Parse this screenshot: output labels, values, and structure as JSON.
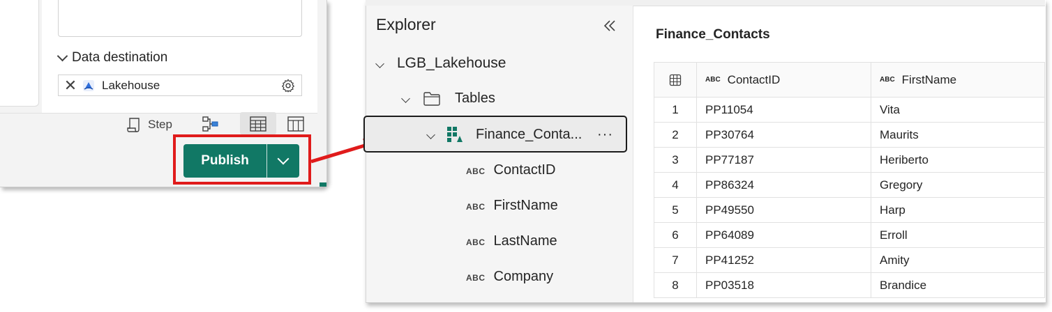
{
  "left_window": {
    "data_destination_label": "Data destination",
    "destination_value": "Lakehouse",
    "step_label": "Step",
    "publish_label": "Publish"
  },
  "explorer": {
    "title": "Explorer",
    "lakehouse": "LGB_Lakehouse",
    "tables_folder": "Tables",
    "selected_table": "Finance_Conta...",
    "columns": [
      {
        "type": "ABC",
        "name": "ContactID"
      },
      {
        "type": "ABC",
        "name": "FirstName"
      },
      {
        "type": "ABC",
        "name": "LastName"
      },
      {
        "type": "ABC",
        "name": "Company"
      }
    ]
  },
  "table_view": {
    "title": "Finance_Contacts",
    "headers": [
      {
        "type": "ABC",
        "name": "ContactID"
      },
      {
        "type": "ABC",
        "name": "FirstName"
      }
    ],
    "rows": [
      {
        "idx": "1",
        "contact_id": "PP11054",
        "first_name": "Vita"
      },
      {
        "idx": "2",
        "contact_id": "PP30764",
        "first_name": "Maurits"
      },
      {
        "idx": "3",
        "contact_id": "PP77187",
        "first_name": "Heriberto"
      },
      {
        "idx": "4",
        "contact_id": "PP86324",
        "first_name": "Gregory"
      },
      {
        "idx": "5",
        "contact_id": "PP49550",
        "first_name": "Harp"
      },
      {
        "idx": "6",
        "contact_id": "PP64089",
        "first_name": "Erroll"
      },
      {
        "idx": "7",
        "contact_id": "PP41252",
        "first_name": "Amity"
      },
      {
        "idx": "8",
        "contact_id": "PP03518",
        "first_name": "Brandice"
      }
    ]
  },
  "colors": {
    "publish_green": "#117865",
    "highlight_red": "#e01b1b"
  }
}
